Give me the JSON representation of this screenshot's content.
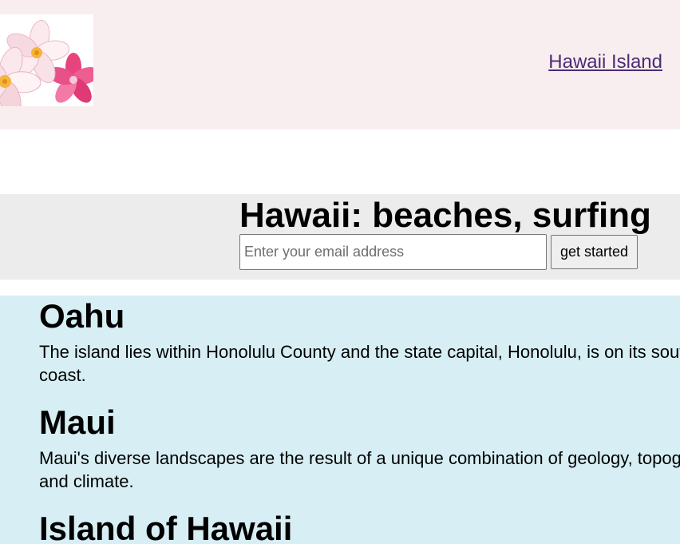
{
  "header": {
    "logo_icon": "plumeria-flower-logo",
    "nav_link": "Hawaii Island"
  },
  "hero": {
    "title": "Hawaii: beaches, surfing",
    "email_placeholder": "Enter your email address",
    "button_label": "get started"
  },
  "islands": [
    {
      "name": "Oahu",
      "text": "The island lies within Honolulu County and the state capital, Honolulu, is on its southeast coast."
    },
    {
      "name": "Maui",
      "text": "Maui's diverse landscapes are the result of a unique combination of geology, topography and climate."
    },
    {
      "name": "Island of Hawaii",
      "text": ""
    }
  ],
  "colors": {
    "header_bg": "#f8eef0",
    "hero_bg": "#ececec",
    "content_bg": "#d7eff4",
    "link": "#4d2b73"
  }
}
